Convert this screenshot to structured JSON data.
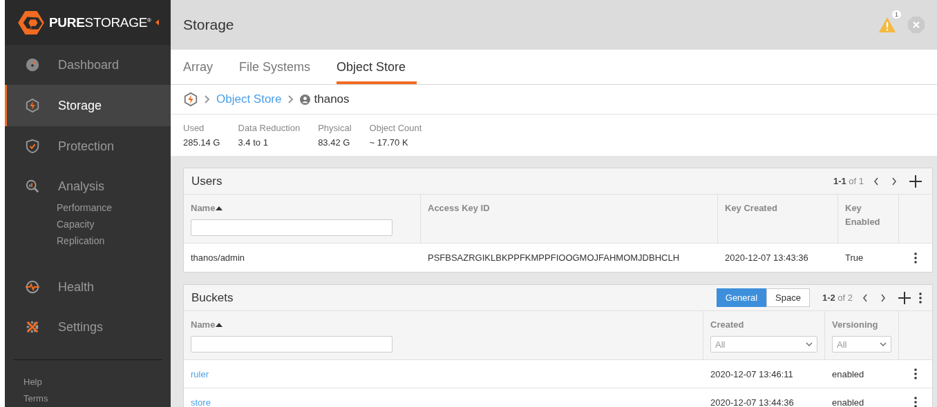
{
  "sidebar": {
    "logo": "**PURE**STORAGE$^{®}$",
    "items": [
      {
        "kind": "dashboard",
        "label": "Dashboard",
        "selected": false
      },
      {
        "kind": "storage",
        "label": "Storage",
        "selected": true
      },
      {
        "kind": "protection",
        "label": "Protection",
        "selected": false
      },
      {
        "kind": "analysis",
        "label": "Analysis",
        "selected": false,
        "children": [
          {
            "label": "Performance"
          },
          {
            "label": "Capacity"
          },
          {
            "label": "Replication"
          }
        ]
      },
      {
        "kind": "health",
        "label": "Health",
        "selected": false
      },
      {
        "kind": "settings",
        "label": "Settings",
        "selected": false
      }
    ],
    "footer_links": [
      "Help",
      "Terms"
    ]
  },
  "header": {
    "title": "Storage",
    "alert_count": "1"
  },
  "tabs": [
    {
      "label": "Array",
      "selected": false
    },
    {
      "label": "File Systems",
      "selected": false
    },
    {
      "label": "Object Store",
      "selected": true
    }
  ],
  "breadcrumb": {
    "link": "Object Store",
    "current": "thanos"
  },
  "stats": [
    {
      "label": "Used",
      "value": "285.14 G"
    },
    {
      "label": "Data Reduction",
      "value": "3.4 to 1"
    },
    {
      "label": "Physical",
      "value": "83.42 G"
    },
    {
      "label": "Object Count",
      "value": "~ 17.70 K"
    }
  ],
  "users": {
    "title": "Users",
    "range": "1-1",
    "total": "of 1",
    "columns": [
      {
        "label": "Name",
        "sorted": true,
        "filter": {
          "kind": "text"
        }
      },
      {
        "label": "Access Key ID",
        "sorted": false
      },
      {
        "label": "Key Created",
        "sorted": false
      },
      {
        "label": "Key Enabled",
        "sorted": false
      }
    ],
    "rows": [
      {
        "cells": [
          "thanos/admin",
          "PSFBSAZRGIKLBKPPFKMPPFIOOGMOJFAHMOMJDBHCLH",
          "2020-12-07 13:43:36",
          "True"
        ]
      }
    ]
  },
  "buckets": {
    "title": "Buckets",
    "views": [
      {
        "label": "General",
        "selected": true
      },
      {
        "label": "Space",
        "selected": false
      }
    ],
    "range": "1-2",
    "total": "of 2",
    "columns": [
      {
        "label": "Name",
        "sorted": true,
        "filter": {
          "kind": "text"
        }
      },
      {
        "label": "Created",
        "sorted": false,
        "filter": {
          "kind": "select",
          "value": "All"
        }
      },
      {
        "label": "Versioning",
        "sorted": false,
        "filter": {
          "kind": "select",
          "value": "All"
        }
      }
    ],
    "rows": [
      {
        "cells": [
          "ruler",
          "2020-12-07 13:46:11",
          "enabled"
        ]
      },
      {
        "cells": [
          "store",
          "2020-12-07 13:44:36",
          "enabled"
        ]
      }
    ]
  }
}
